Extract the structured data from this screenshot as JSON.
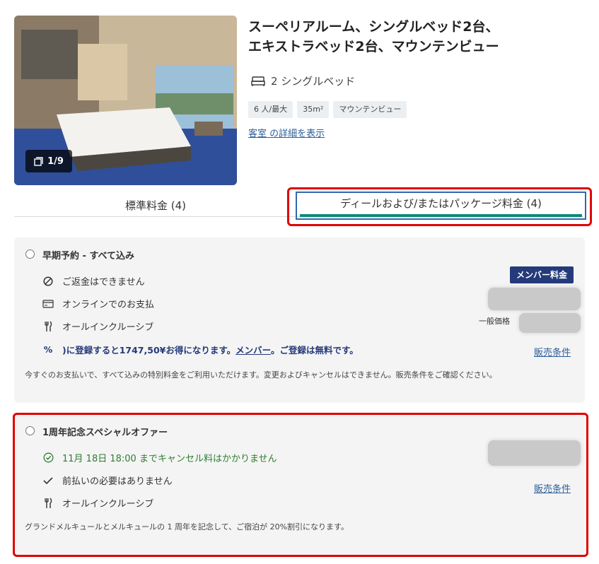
{
  "room": {
    "photo_counter": "1/9",
    "title_line1": "スーペリアルーム、シングルベッド2台、",
    "title_line2": "エキストラベッド2台、マウンテンビュー",
    "bed": "2 シングルベッド",
    "chips": [
      "6 人/最大",
      "35m²",
      "マウンテンビュー"
    ],
    "details_link": "客室 の詳細を表示"
  },
  "tabs": {
    "standard": "標準料金 (4)",
    "deals": "ディールおよび/またはパッケージ料金 (4)"
  },
  "rate1": {
    "name": "早期予約 - すべて込み",
    "features": [
      "ご返金はできません",
      "オンラインでのお支払",
      "オールインクルーシブ"
    ],
    "promo_prefix": ")に登録すると1747,50¥お得になります。",
    "promo_link": "メンバー",
    "promo_suffix": "。ご登録は無料です。",
    "member_badge": "メンバー料金",
    "general_label": "一般価格",
    "terms": "販売条件",
    "note": "今すぐのお支払いで、すべて込みの特別料金をご利用いただけます。変更およびキャンセルはできません。販売条件をご確認ください。"
  },
  "rate2": {
    "name": "1周年記念スペシャルオファー",
    "free_cancel": "11月 18日 18:00 までキャンセル料はかかりません",
    "no_prepay": "前払いの必要はありません",
    "all_inclusive": "オールインクルーシブ",
    "terms": "販売条件",
    "note": "グランドメルキュールとメルキュールの 1 周年を記念して、ご宿泊が 20%割引になります。"
  },
  "colors": {
    "accent_blue": "#243a7a",
    "tab_underline": "#0b8a77",
    "highlight_red": "#e00000",
    "link_blue": "#2d5f9a",
    "green": "#2e7d32"
  }
}
